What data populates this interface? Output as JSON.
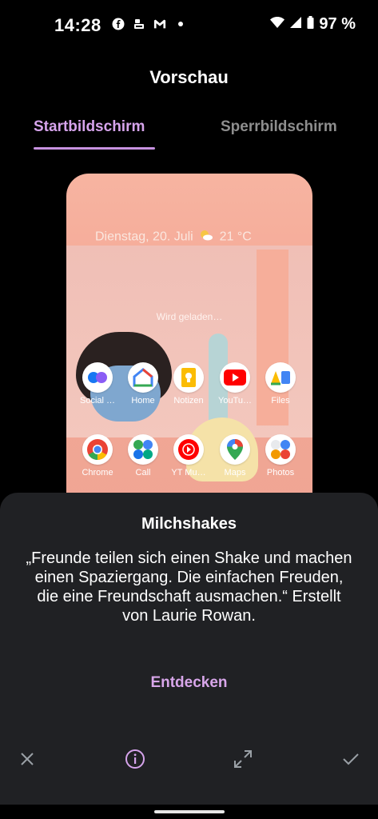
{
  "status_bar": {
    "time": "14:28",
    "battery": "97 %",
    "left_icons": [
      "facebook-icon",
      "hunter-icon",
      "gmail-icon",
      "dot-icon"
    ],
    "right_icons": [
      "wifi-icon",
      "signal-icon",
      "battery-icon"
    ]
  },
  "header": {
    "title": "Vorschau"
  },
  "tabs": [
    {
      "label": "Startbildschirm",
      "active": true
    },
    {
      "label": "Sperrbildschirm",
      "active": false
    }
  ],
  "preview": {
    "date_weather": "Dienstag, 20. Juli",
    "weather_icon": "sun-cloud-icon",
    "temperature": "21 °C",
    "loading": "Wird geladen…",
    "apps_row1": [
      {
        "label": "Social …",
        "icon": "social-folder-icon"
      },
      {
        "label": "Home",
        "icon": "google-home-icon"
      },
      {
        "label": "Notizen",
        "icon": "keep-notes-icon"
      },
      {
        "label": "YouTu…",
        "icon": "youtube-icon"
      },
      {
        "label": "Files",
        "icon": "files-icon"
      }
    ],
    "apps_row2": [
      {
        "label": "Chrome",
        "icon": "chrome-icon"
      },
      {
        "label": "Call",
        "icon": "call-folder-icon"
      },
      {
        "label": "YT Mu…",
        "icon": "youtube-music-icon"
      },
      {
        "label": "Maps",
        "icon": "maps-icon"
      },
      {
        "label": "Photos",
        "icon": "photos-folder-icon"
      }
    ]
  },
  "sheet": {
    "title": "Milchshakes",
    "description": "„Freunde teilen sich einen Shake und machen einen Spaziergang. Die einfachen Freuden, die eine Freundschaft ausmachen.“ Erstellt von Laurie Rowan.",
    "explore_label": "Entdecken",
    "actions": [
      "close-icon",
      "info-icon",
      "fullscreen-icon",
      "check-icon"
    ]
  },
  "colors": {
    "accent": "#d6a4ec",
    "sheet_bg": "#202124",
    "inactive_tab": "#8e8e8e"
  }
}
